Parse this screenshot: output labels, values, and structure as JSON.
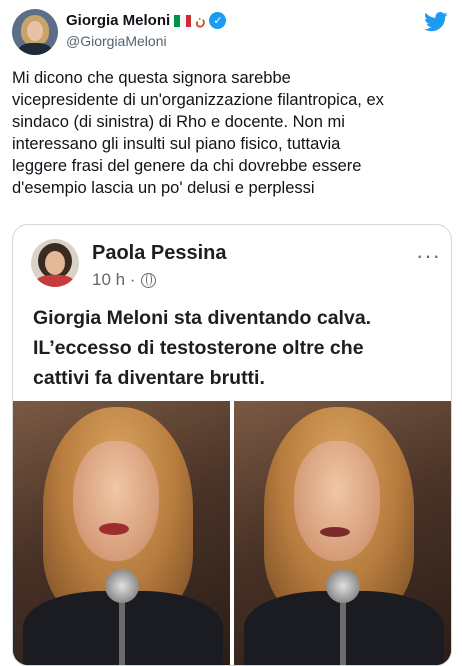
{
  "author": {
    "name": "Giorgia Meloni",
    "handle": "@GiorgiaMeloni",
    "noon_glyph": "ن",
    "flag_colors": [
      "#009246",
      "#ffffff",
      "#ce2b37"
    ],
    "verified_color": "#1d9bf0"
  },
  "tweet": {
    "text": "Mi dicono che questa signora sarebbe\nvicepresidente di un'organizzazione filantropica, ex\nsindaco (di sinistra) di Rho e docente. Non mi\ninteressano gli insulti sul piano fisico, tuttavia\nleggere frasi del genere da chi dovrebbe essere\nd'esempio lascia un po' delusi e perplessi"
  },
  "embedded_post": {
    "name": "Paola Pessina",
    "time": "10 h ·",
    "more": "···",
    "text": "Giorgia Meloni sta diventando calva.\nIL’eccesso di testosterone oltre che\ncattivi fa diventare brutti."
  },
  "icons": {
    "platform": "twitter-bird-icon",
    "verified": "verified-badge-icon",
    "privacy": "globe-icon"
  },
  "colors": {
    "twitter_blue": "#1d9bf0",
    "text": "#0f1419",
    "muted": "#536471",
    "border": "#cfd9de"
  }
}
